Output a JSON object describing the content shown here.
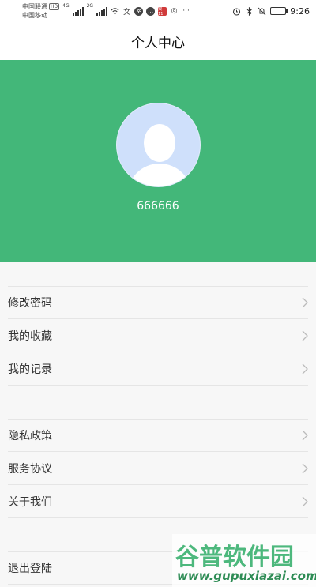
{
  "status_bar": {
    "carrier_1": "中国联通",
    "carrier_1_badge": "HD",
    "carrier_2": "中国移动",
    "net_1": "4G",
    "net_2": "2G",
    "more": "···",
    "time": "9:26",
    "battery_level": 0.55
  },
  "nav": {
    "title": "个人中心"
  },
  "profile": {
    "username": "666666"
  },
  "menu_group_1": [
    {
      "label": "修改密码"
    },
    {
      "label": "我的收藏"
    },
    {
      "label": "我的记录"
    }
  ],
  "menu_group_2": [
    {
      "label": "隐私政策"
    },
    {
      "label": "服务协议"
    },
    {
      "label": "关于我们"
    }
  ],
  "menu_group_3": [
    {
      "label": "退出登陆"
    }
  ],
  "watermark": {
    "brand": "谷普软件园",
    "url": "www.gupuxiazai.com"
  },
  "colors": {
    "header_green": "#43b779",
    "avatar_bg": "#cfe0fb"
  }
}
